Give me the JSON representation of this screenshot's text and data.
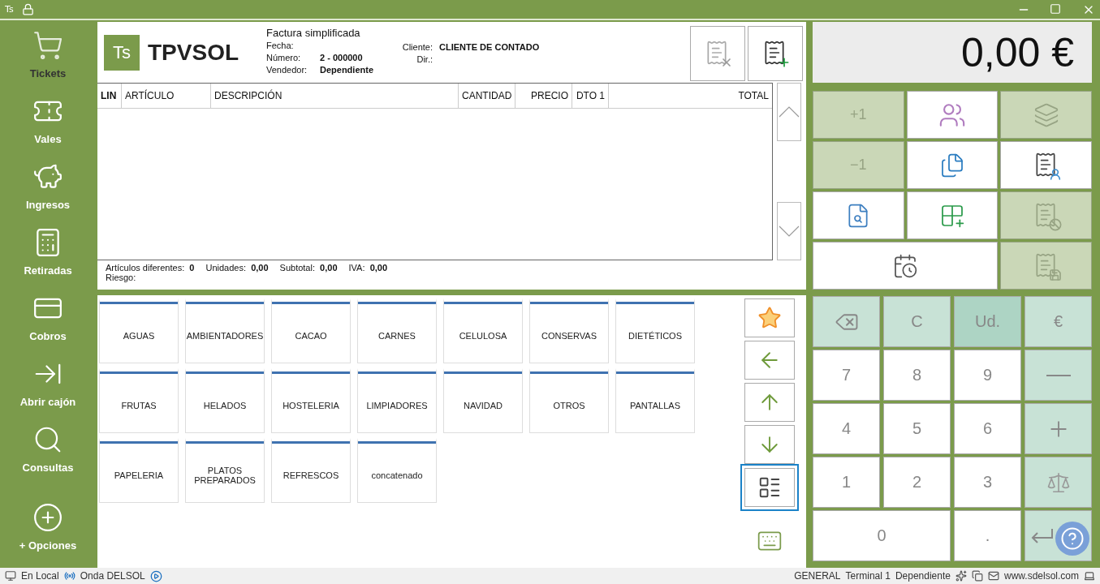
{
  "title_bar": {
    "app_badge": "Ts"
  },
  "sidebar": {
    "items": [
      {
        "label": "Tickets",
        "selected": true
      },
      {
        "label": "Vales",
        "selected": false
      },
      {
        "label": "Ingresos",
        "selected": false
      },
      {
        "label": "Retiradas",
        "selected": false
      },
      {
        "label": "Cobros",
        "selected": false
      },
      {
        "label": "Abrir cajón",
        "selected": false
      },
      {
        "label": "Consultas",
        "selected": false
      }
    ],
    "options": "+ Opciones"
  },
  "header": {
    "logo_badge": "Ts",
    "logo_text": "TPVSOL",
    "doc_title": "Factura simplificada",
    "left_fields": [
      {
        "label": "Fecha:"
      },
      {
        "label": "Número:",
        "value": "2 - 000000"
      },
      {
        "label": "Vendedor:",
        "value": "Dependiente"
      }
    ],
    "right_fields": [
      {
        "label": "Cliente:",
        "value": "CLIENTE DE CONTADO"
      },
      {
        "label": "Dir.:"
      }
    ],
    "buttons": [
      {
        "disabled": true
      },
      {
        "disabled": false
      }
    ]
  },
  "table": {
    "columns": [
      "LIN",
      "ARTÍCULO",
      "DESCRIPCIÓN",
      "CANTIDAD",
      "PRECIO",
      "DTO 1",
      "TOTAL"
    ]
  },
  "summary": {
    "items": [
      {
        "label": "Artículos diferentes:",
        "value": "0"
      },
      {
        "label": "Unidades:",
        "value": "0,00"
      },
      {
        "label": "Subtotal:",
        "value": "0,00"
      },
      {
        "label": "IVA:",
        "value": "0,00"
      }
    ],
    "risk_label": "Riesgo:"
  },
  "categories": [
    "AGUAS",
    "AMBIENTADORES",
    "CACAO",
    "CARNES",
    "CELULOSA",
    "CONSERVAS",
    "DIETÉTICOS",
    "FRUTAS",
    "HELADOS",
    "HOSTELERIA",
    "LIMPIADORES",
    "NAVIDAD",
    "OTROS",
    "PANTALLAS",
    "PAPELERIA",
    "PLATOS PREPARADOS",
    "REFRESCOS",
    "concatenado"
  ],
  "nav_buttons": [
    {
      "focused": false
    },
    {
      "focused": false
    },
    {
      "focused": false
    },
    {
      "focused": false
    },
    {
      "focused": true
    }
  ],
  "total": "0,00 €",
  "functions": [
    {
      "label": "+1",
      "disabled": true
    },
    {
      "disabled": false
    },
    {
      "disabled": true
    },
    {
      "label": "−1",
      "disabled": true
    },
    {
      "disabled": false
    },
    {
      "disabled": false
    },
    {
      "disabled": false
    },
    {
      "disabled": false
    },
    {
      "disabled": true
    },
    {
      "disabled": false
    },
    {
      "disabled": true
    }
  ],
  "keypad": [
    {
      "kind": "function",
      "selected": false
    },
    {
      "label": "C",
      "kind": "function",
      "selected": false
    },
    {
      "label": "Ud.",
      "kind": "function",
      "selected": true
    },
    {
      "label": "€",
      "kind": "function",
      "selected": false
    },
    {
      "label": "7",
      "kind": "digit",
      "selected": false
    },
    {
      "label": "8",
      "kind": "digit",
      "selected": false
    },
    {
      "label": "9",
      "kind": "digit",
      "selected": false
    },
    {
      "kind": "function",
      "selected": false
    },
    {
      "label": "4",
      "kind": "digit",
      "selected": false
    },
    {
      "label": "5",
      "kind": "digit",
      "selected": false
    },
    {
      "label": "6",
      "kind": "digit",
      "selected": false
    },
    {
      "kind": "function",
      "selected": false
    },
    {
      "label": "1",
      "kind": "digit",
      "selected": false
    },
    {
      "label": "2",
      "kind": "digit",
      "selected": false
    },
    {
      "label": "3",
      "kind": "digit",
      "selected": false
    },
    {
      "kind": "function",
      "selected": false
    },
    {
      "label": "0",
      "kind": "digit",
      "selected": false
    },
    {
      "label": ".",
      "kind": "digit",
      "selected": false
    },
    {
      "kind": "function",
      "selected": false
    }
  ],
  "status_bar": {
    "left": [
      "En Local",
      "Onda DELSOL"
    ],
    "right": [
      "GENERAL",
      "Terminal 1",
      "Dependiente"
    ],
    "website": "www.sdelsol.com"
  }
}
